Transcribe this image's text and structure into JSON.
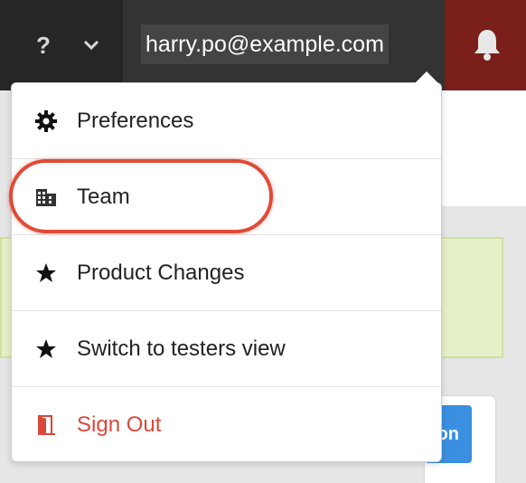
{
  "header": {
    "help_label": "?",
    "user_email": "harry.po@example.com",
    "icons": {
      "help": "question-mark",
      "chevron": "chevron-down-icon",
      "notifications": "bell-icon"
    },
    "colors": {
      "help_bg": "#262626",
      "user_bg": "#333333",
      "notify_bg": "#7a1f1a"
    }
  },
  "menu": {
    "items": [
      {
        "label": "Preferences",
        "icon": "gear-icon"
      },
      {
        "label": "Team",
        "icon": "building-icon",
        "highlighted": true
      },
      {
        "label": "Product Changes",
        "icon": "star-icon"
      },
      {
        "label": "Switch to testers view",
        "icon": "star-icon"
      },
      {
        "label": "Sign Out",
        "icon": "door-icon",
        "color": "#d9483b"
      }
    ]
  },
  "background": {
    "button_label": "on",
    "colors": {
      "banner": "#e6f0c8",
      "button": "#3b8fe0"
    }
  }
}
